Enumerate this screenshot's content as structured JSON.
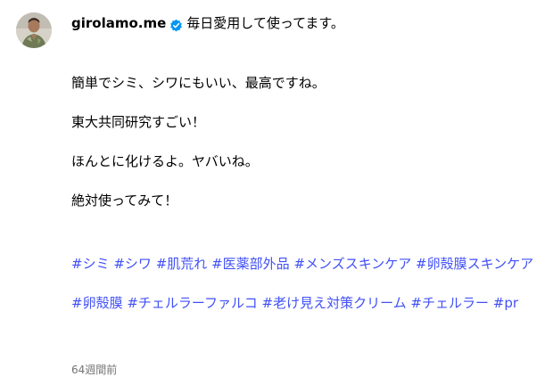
{
  "post": {
    "username": "girolamo.me",
    "first_line_text": "毎日愛用して使ってます。",
    "paragraphs": [
      "簡単でシミ、シワにもいい、最高ですね。",
      "東大共同研究すごい！",
      "ほんとに化けるよ。ヤバいね。",
      "絶対使ってみて！"
    ],
    "hashtags_block1": [
      "#シミ",
      "#シワ",
      "#肌荒れ",
      "#医薬部外品",
      "#メンズスキンケア",
      "#卵殻膜スキンケア"
    ],
    "hashtags_block2": [
      "#卵殻膜",
      "#チェルラーファルコ",
      "#老け見え対策クリーム",
      "#チェルラー",
      "#pr"
    ],
    "timestamp": "64週間前"
  },
  "colors": {
    "link": "#4150f7",
    "verified": "#0095f6",
    "timestamp": "#737373"
  },
  "icons": {
    "avatar": "profile-photo",
    "verified": "verified-badge-icon"
  }
}
